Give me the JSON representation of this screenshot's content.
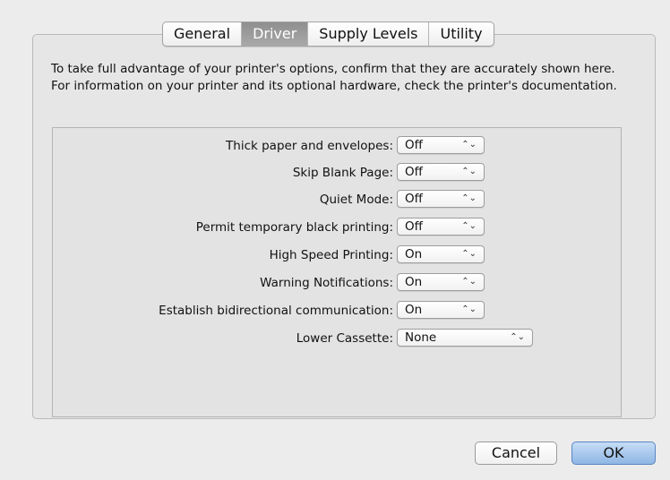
{
  "tabs": [
    {
      "label": "General",
      "active": false
    },
    {
      "label": "Driver",
      "active": true
    },
    {
      "label": "Supply Levels",
      "active": false
    },
    {
      "label": "Utility",
      "active": false
    }
  ],
  "description": "To take full advantage of your printer's options, confirm that they are accurately shown here. For information on your printer and its optional hardware, check the printer's documentation.",
  "options": [
    {
      "label": "Thick paper and envelopes:",
      "value": "Off"
    },
    {
      "label": "Skip Blank Page:",
      "value": "Off"
    },
    {
      "label": "Quiet Mode:",
      "value": "Off"
    },
    {
      "label": "Permit temporary black printing:",
      "value": "Off"
    },
    {
      "label": "High Speed Printing:",
      "value": "On"
    },
    {
      "label": "Warning Notifications:",
      "value": "On"
    },
    {
      "label": "Establish bidirectional communication:",
      "value": "On"
    },
    {
      "label": "Lower Cassette:",
      "value": "None"
    }
  ],
  "popup_arrow_glyph": "⌃⌄",
  "buttons": {
    "cancel": "Cancel",
    "ok": "OK"
  },
  "colors": {
    "default_button": "#8fb6e4",
    "active_tab": "#9a9a9a"
  }
}
